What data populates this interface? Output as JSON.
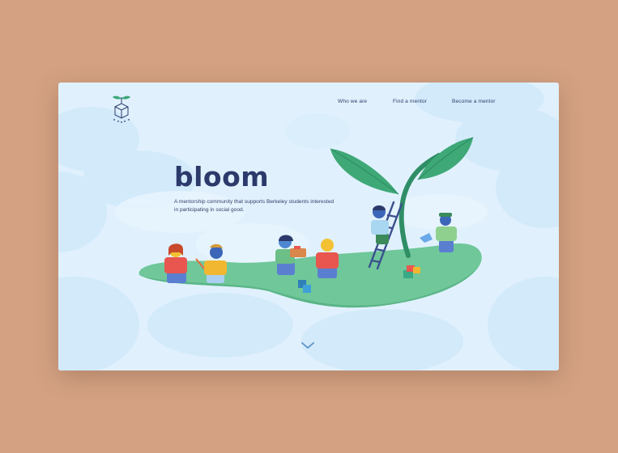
{
  "brand": {
    "name": "bloom",
    "tagline": "A mentorship community that supports Berkeley students interested in participating in social good."
  },
  "nav": {
    "items": [
      {
        "label": "Who we are"
      },
      {
        "label": "Find a mentor"
      },
      {
        "label": "Become a mentor"
      }
    ]
  },
  "icons": {
    "logo": "sprout-cube-logo-icon",
    "scroll": "chevron-down-icon"
  },
  "colors": {
    "page_background": "#d4a283",
    "hero_background": "#e0f1fd",
    "title": "#2b3a6a",
    "island_green": "#6fc79a",
    "leaf_green": "#3ea877",
    "chevron": "#5b93c9"
  }
}
